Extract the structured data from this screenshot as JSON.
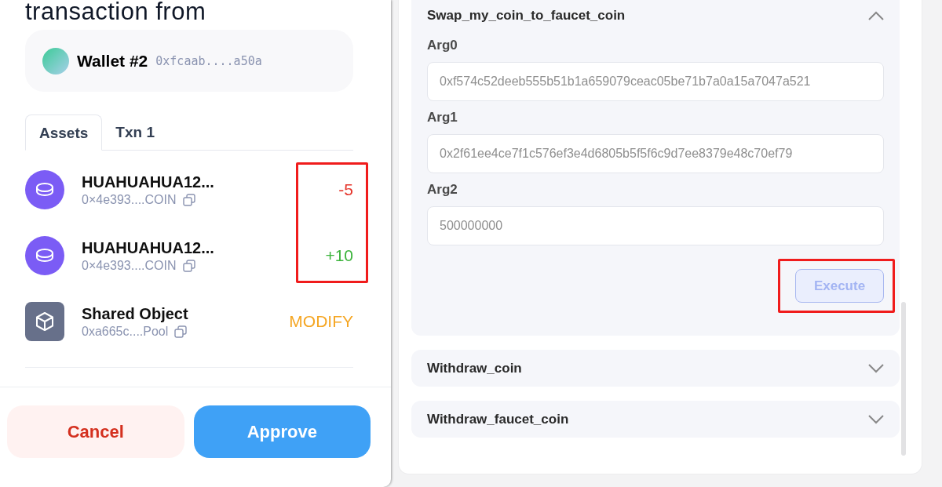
{
  "popup": {
    "title": "transaction from",
    "wallet": {
      "name": "Wallet #2",
      "address": "0xfcaab....a50a"
    },
    "tabs": [
      {
        "label": "Assets",
        "selected": true
      },
      {
        "label": "Txn 1",
        "selected": false
      }
    ],
    "amounts_highlighted": true,
    "assets": [
      {
        "kind": "coin",
        "name": "HUAHUAHUA12...",
        "address": "0×4e393....COIN",
        "change": "-5",
        "color": "#e5342a"
      },
      {
        "kind": "coin",
        "name": "HUAHUAHUA12...",
        "address": "0×4e393....COIN",
        "change": "+10",
        "color": "#3bb33b"
      },
      {
        "kind": "object",
        "name": "Shared Object",
        "address": "0xa665c....Pool",
        "change": "MODIFY",
        "color": "#f5a623"
      }
    ],
    "buttons": [
      {
        "kind": "cancel",
        "label": "Cancel"
      },
      {
        "kind": "approve",
        "label": "Approve"
      }
    ]
  },
  "functions": [
    {
      "name": "Swap_my_coin_to_faucet_coin",
      "expanded": true,
      "args": [
        {
          "label": "Arg0",
          "value": "0xf574c52deeb555b51b1a659079ceac05be71b7a0a15a7047a521"
        },
        {
          "label": "Arg1",
          "value": "0x2f61ee4ce7f1c576ef3e4d6805b5f5f6c9d7ee8379e48c70ef79"
        },
        {
          "label": "Arg2",
          "value": "500000000"
        }
      ],
      "execute": {
        "label": "Execute",
        "disabled": true,
        "highlighted": true
      }
    },
    {
      "name": "Withdraw_coin",
      "expanded": false
    },
    {
      "name": "Withdraw_faucet_coin",
      "expanded": false
    }
  ]
}
